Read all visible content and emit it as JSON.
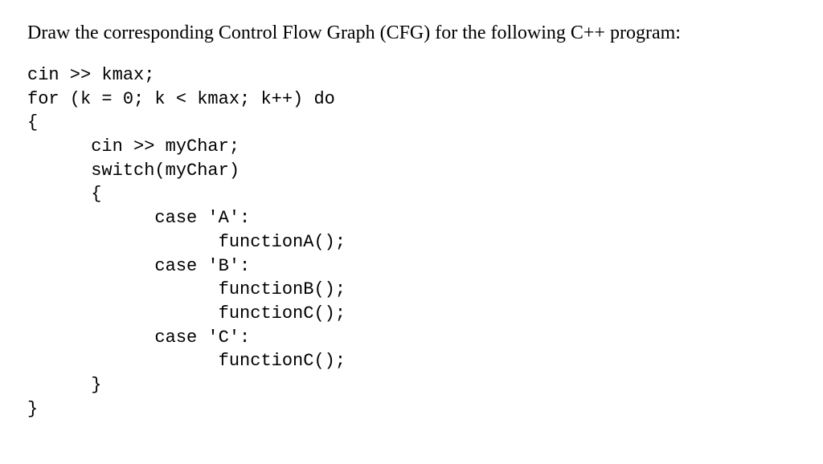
{
  "prompt": "Draw the corresponding Control Flow Graph (CFG) for the following C++ program:",
  "code": {
    "l1": "cin >> kmax;",
    "l2": "for (k = 0; k < kmax; k++) do",
    "l3": "{",
    "l4": "      cin >> myChar;",
    "l5": "      switch(myChar)",
    "l6": "      {",
    "l7": "            case 'A':",
    "l8": "                  functionA();",
    "l9": "            case 'B':",
    "l10": "                  functionB();",
    "l11": "                  functionC();",
    "l12": "            case 'C':",
    "l13": "                  functionC();",
    "l14": "      }",
    "l15": "}"
  }
}
